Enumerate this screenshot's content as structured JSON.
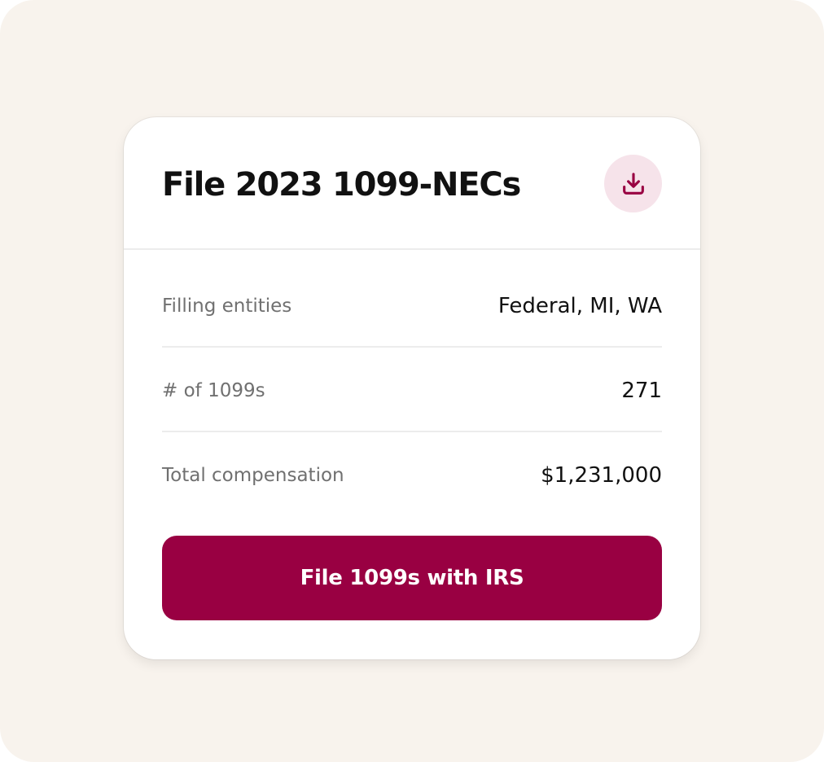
{
  "card": {
    "title": "File 2023 1099-NECs",
    "download_icon": "download-icon",
    "rows": [
      {
        "label": "Filling entities",
        "value": "Federal, MI, WA"
      },
      {
        "label": "# of 1099s",
        "value": "271"
      },
      {
        "label": "Total compensation",
        "value": "$1,231,000"
      }
    ],
    "primary_button_label": "File 1099s with IRS"
  },
  "colors": {
    "background": "#f8f3ed",
    "card": "#ffffff",
    "accent": "#990042",
    "icon_bg": "#f6e3ea",
    "label_text": "#707070",
    "value_text": "#111111"
  }
}
